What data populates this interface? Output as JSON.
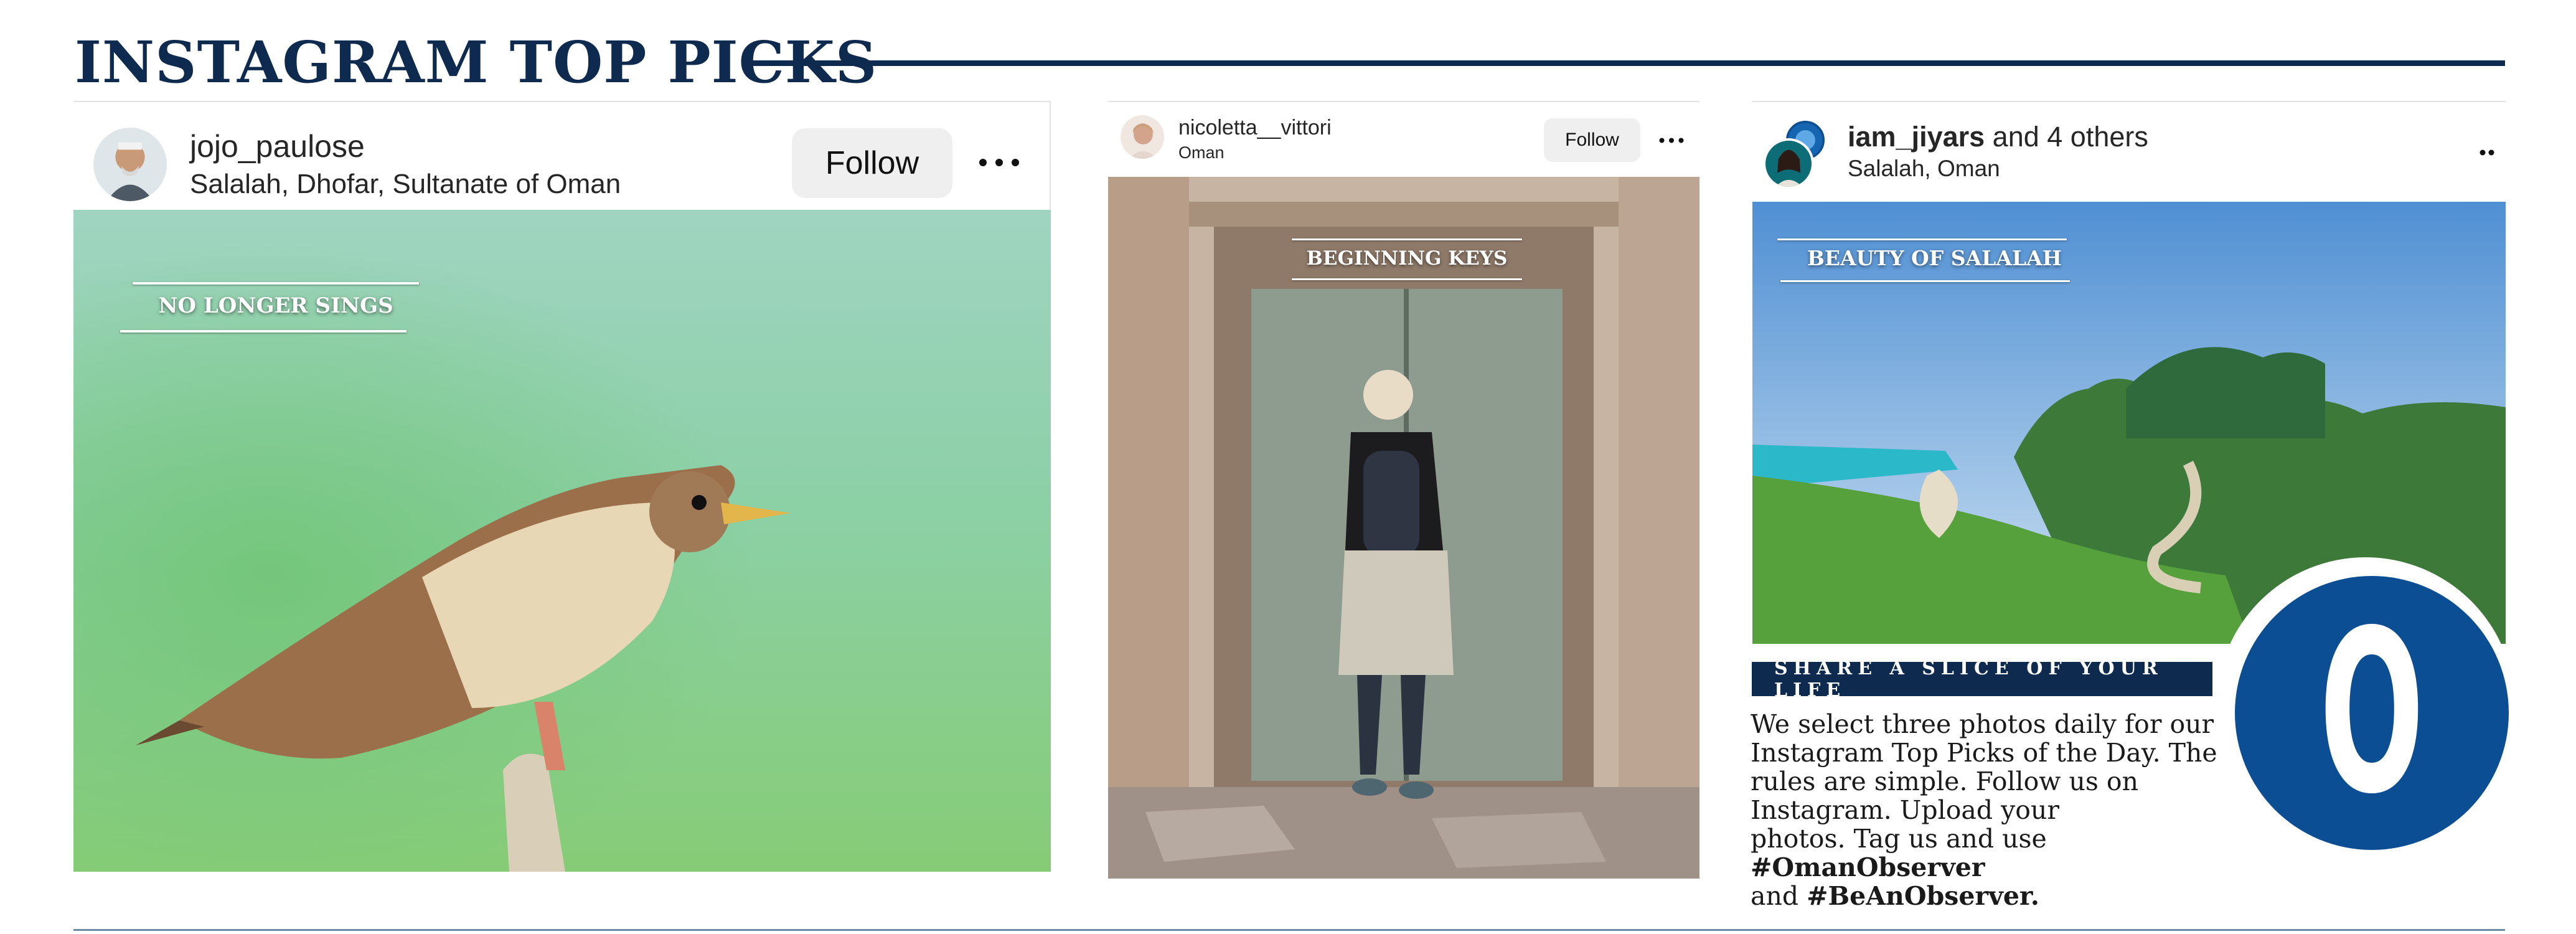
{
  "page": {
    "title": "INSTAGRAM TOP PICKS"
  },
  "posts": [
    {
      "username": "jojo_paulose",
      "location": "Salalah, Dhofar, Sultanate of Oman",
      "follow_label": "Follow",
      "more_icon": "more-options-icon",
      "caption": "NO LONGER SINGS"
    },
    {
      "username": "nicoletta__vittori",
      "location": "Oman",
      "follow_label": "Follow",
      "more_icon": "more-options-icon",
      "caption": "BEGINNING KEYS"
    },
    {
      "username": "iam_jiyars",
      "username_suffix": " and 4 others",
      "location": "Salalah, Oman",
      "more_icon": "more-options-icon",
      "caption": "BEAUTY OF SALALAH"
    }
  ],
  "info": {
    "banner": "SHARE A SLICE OF YOUR LIFE",
    "body_lines": [
      "We select three photos daily for our",
      "Instagram Top Picks of the Day. The",
      "rules are simple. Follow us on",
      "Instagram. Upload your"
    ],
    "body_line5_prefix": "photos. Tag us and use ",
    "hashtag1": "#OmanObserver",
    "body_line6_prefix": "and ",
    "hashtag2": "#BeAnObserver.",
    "logo_letter": "O"
  },
  "colors": {
    "brand_navy": "#0e2a4f",
    "logo_blue": "#0b4e93",
    "follow_bg": "#efefef"
  }
}
